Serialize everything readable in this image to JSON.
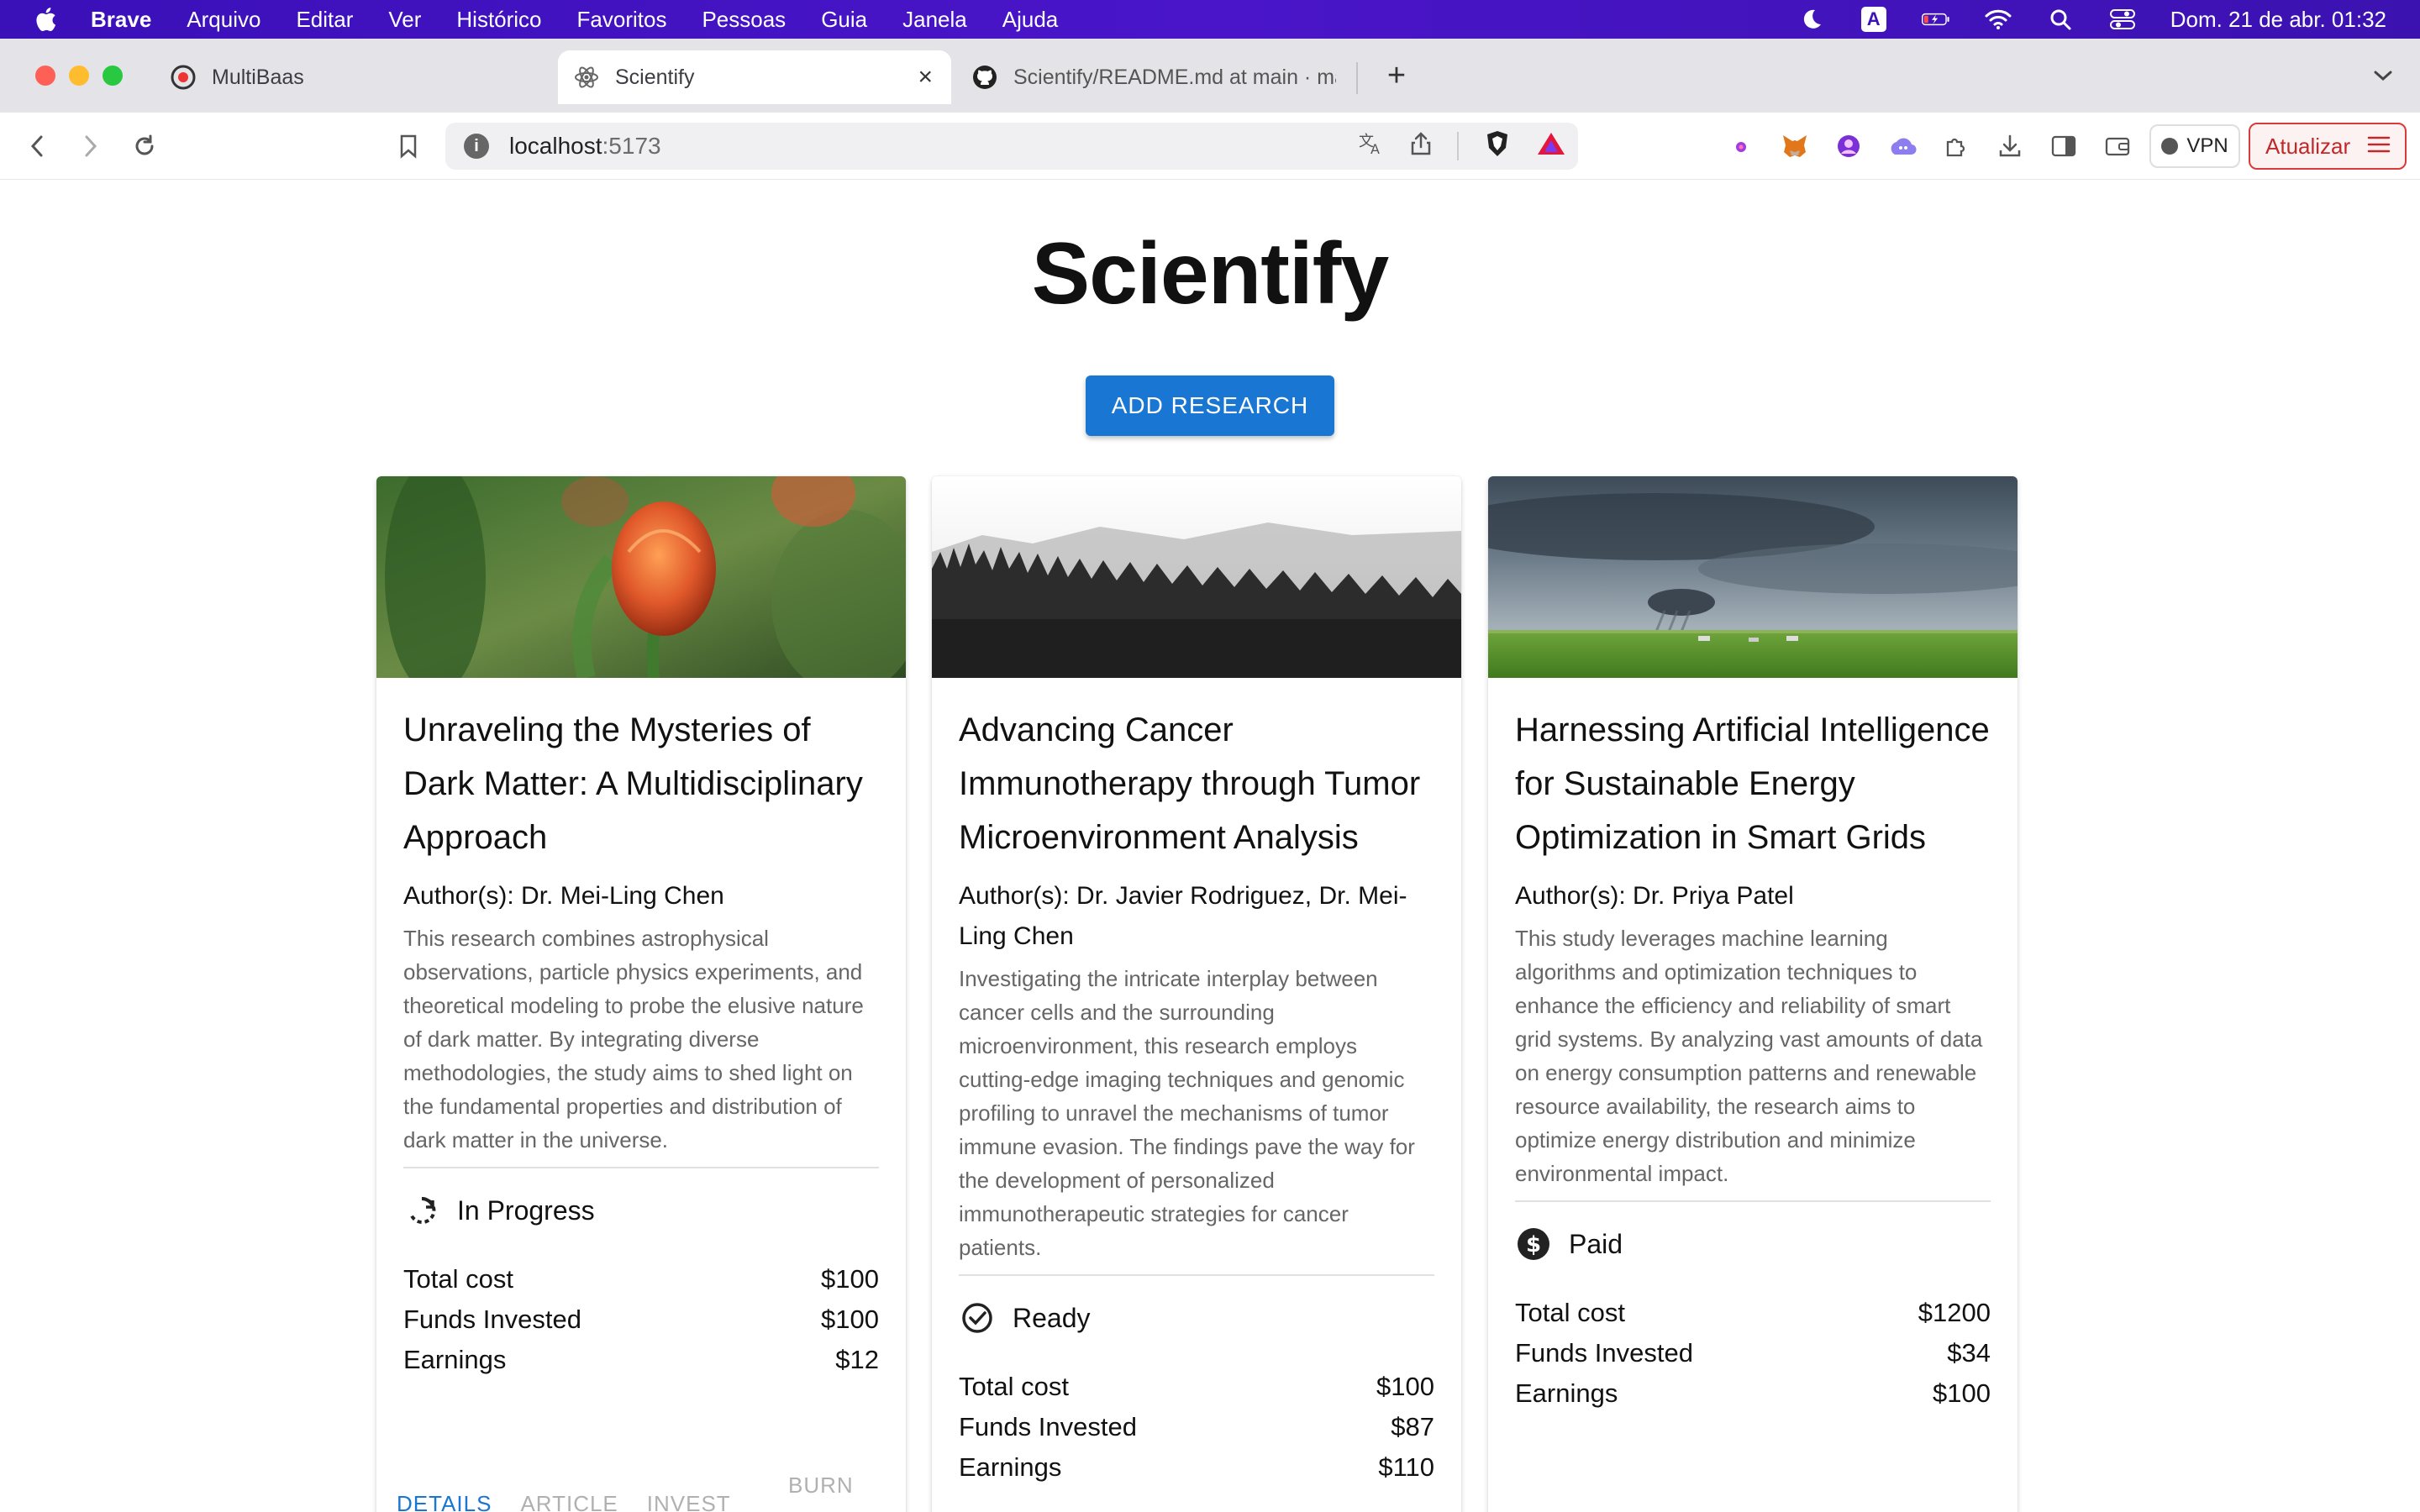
{
  "menubar": {
    "app": "Brave",
    "items": [
      "Arquivo",
      "Editar",
      "Ver",
      "Histórico",
      "Favoritos",
      "Pessoas",
      "Guia",
      "Janela",
      "Ajuda"
    ],
    "clock": "Dom. 21 de abr.  01:32",
    "input_source": "A"
  },
  "tabs": [
    {
      "label": "MultiBaas",
      "favicon": "multibaas-icon"
    },
    {
      "label": "Scientify",
      "favicon": "react-icon",
      "active": true
    },
    {
      "label": "Scientify/README.md at main · ma",
      "favicon": "github-icon"
    }
  ],
  "toolbar": {
    "url_host": "localhost",
    "url_port": ":5173",
    "vpn_label": "VPN",
    "update_label": "Atualizar"
  },
  "page": {
    "title": "Scientify",
    "add_button": "ADD RESEARCH",
    "accent_color": "#1976d2"
  },
  "cards": [
    {
      "title": "Unraveling the Mysteries of Dark Matter: A Multidisciplinary Approach",
      "authors": "Author(s): Dr. Mei-Ling Chen",
      "description": "This research combines astrophysical observations, particle physics experiments, and theoretical modeling to probe the elusive nature of dark matter. By integrating diverse methodologies, the study aims to shed light on the fundamental properties and distribution of dark matter in the universe.",
      "status": "In Progress",
      "status_icon": "progress-icon",
      "image": "tulip-photo",
      "stats": [
        {
          "label": "Total cost",
          "value": "$100"
        },
        {
          "label": "Funds Invested",
          "value": "$100"
        },
        {
          "label": "Earnings",
          "value": "$12"
        }
      ],
      "actions": [
        "DETAILS",
        "ARTICLE",
        "INVEST",
        "BURN"
      ]
    },
    {
      "title": "Advancing Cancer Immunotherapy through Tumor Microenvironment Analysis",
      "authors": "Author(s): Dr. Javier Rodriguez, Dr. Mei-Ling Chen",
      "description": "Investigating the intricate interplay between cancer cells and the surrounding microenvironment, this research employs cutting-edge imaging techniques and genomic profiling to unravel the mechanisms of tumor immune evasion. The findings pave the way for the development of personalized immunotherapeutic strategies for cancer patients.",
      "status": "Ready",
      "status_icon": "check-circle-icon",
      "image": "forest-photo",
      "stats": [
        {
          "label": "Total cost",
          "value": "$100"
        },
        {
          "label": "Funds Invested",
          "value": "$87"
        },
        {
          "label": "Earnings",
          "value": "$110"
        }
      ]
    },
    {
      "title": "Harnessing Artificial Intelligence for Sustainable Energy Optimization in Smart Grids",
      "authors": "Author(s): Dr. Priya Patel",
      "description": "This study leverages machine learning algorithms and optimization techniques to enhance the efficiency and reliability of smart grid systems. By analyzing vast amounts of data on energy consumption patterns and renewable resource availability, the research aims to optimize energy distribution and minimize environmental impact.",
      "status": "Paid",
      "status_icon": "dollar-circle-icon",
      "image": "storm-field-photo",
      "stats": [
        {
          "label": "Total cost",
          "value": "$1200"
        },
        {
          "label": "Funds Invested",
          "value": "$34"
        },
        {
          "label": "Earnings",
          "value": "$100"
        }
      ]
    }
  ]
}
